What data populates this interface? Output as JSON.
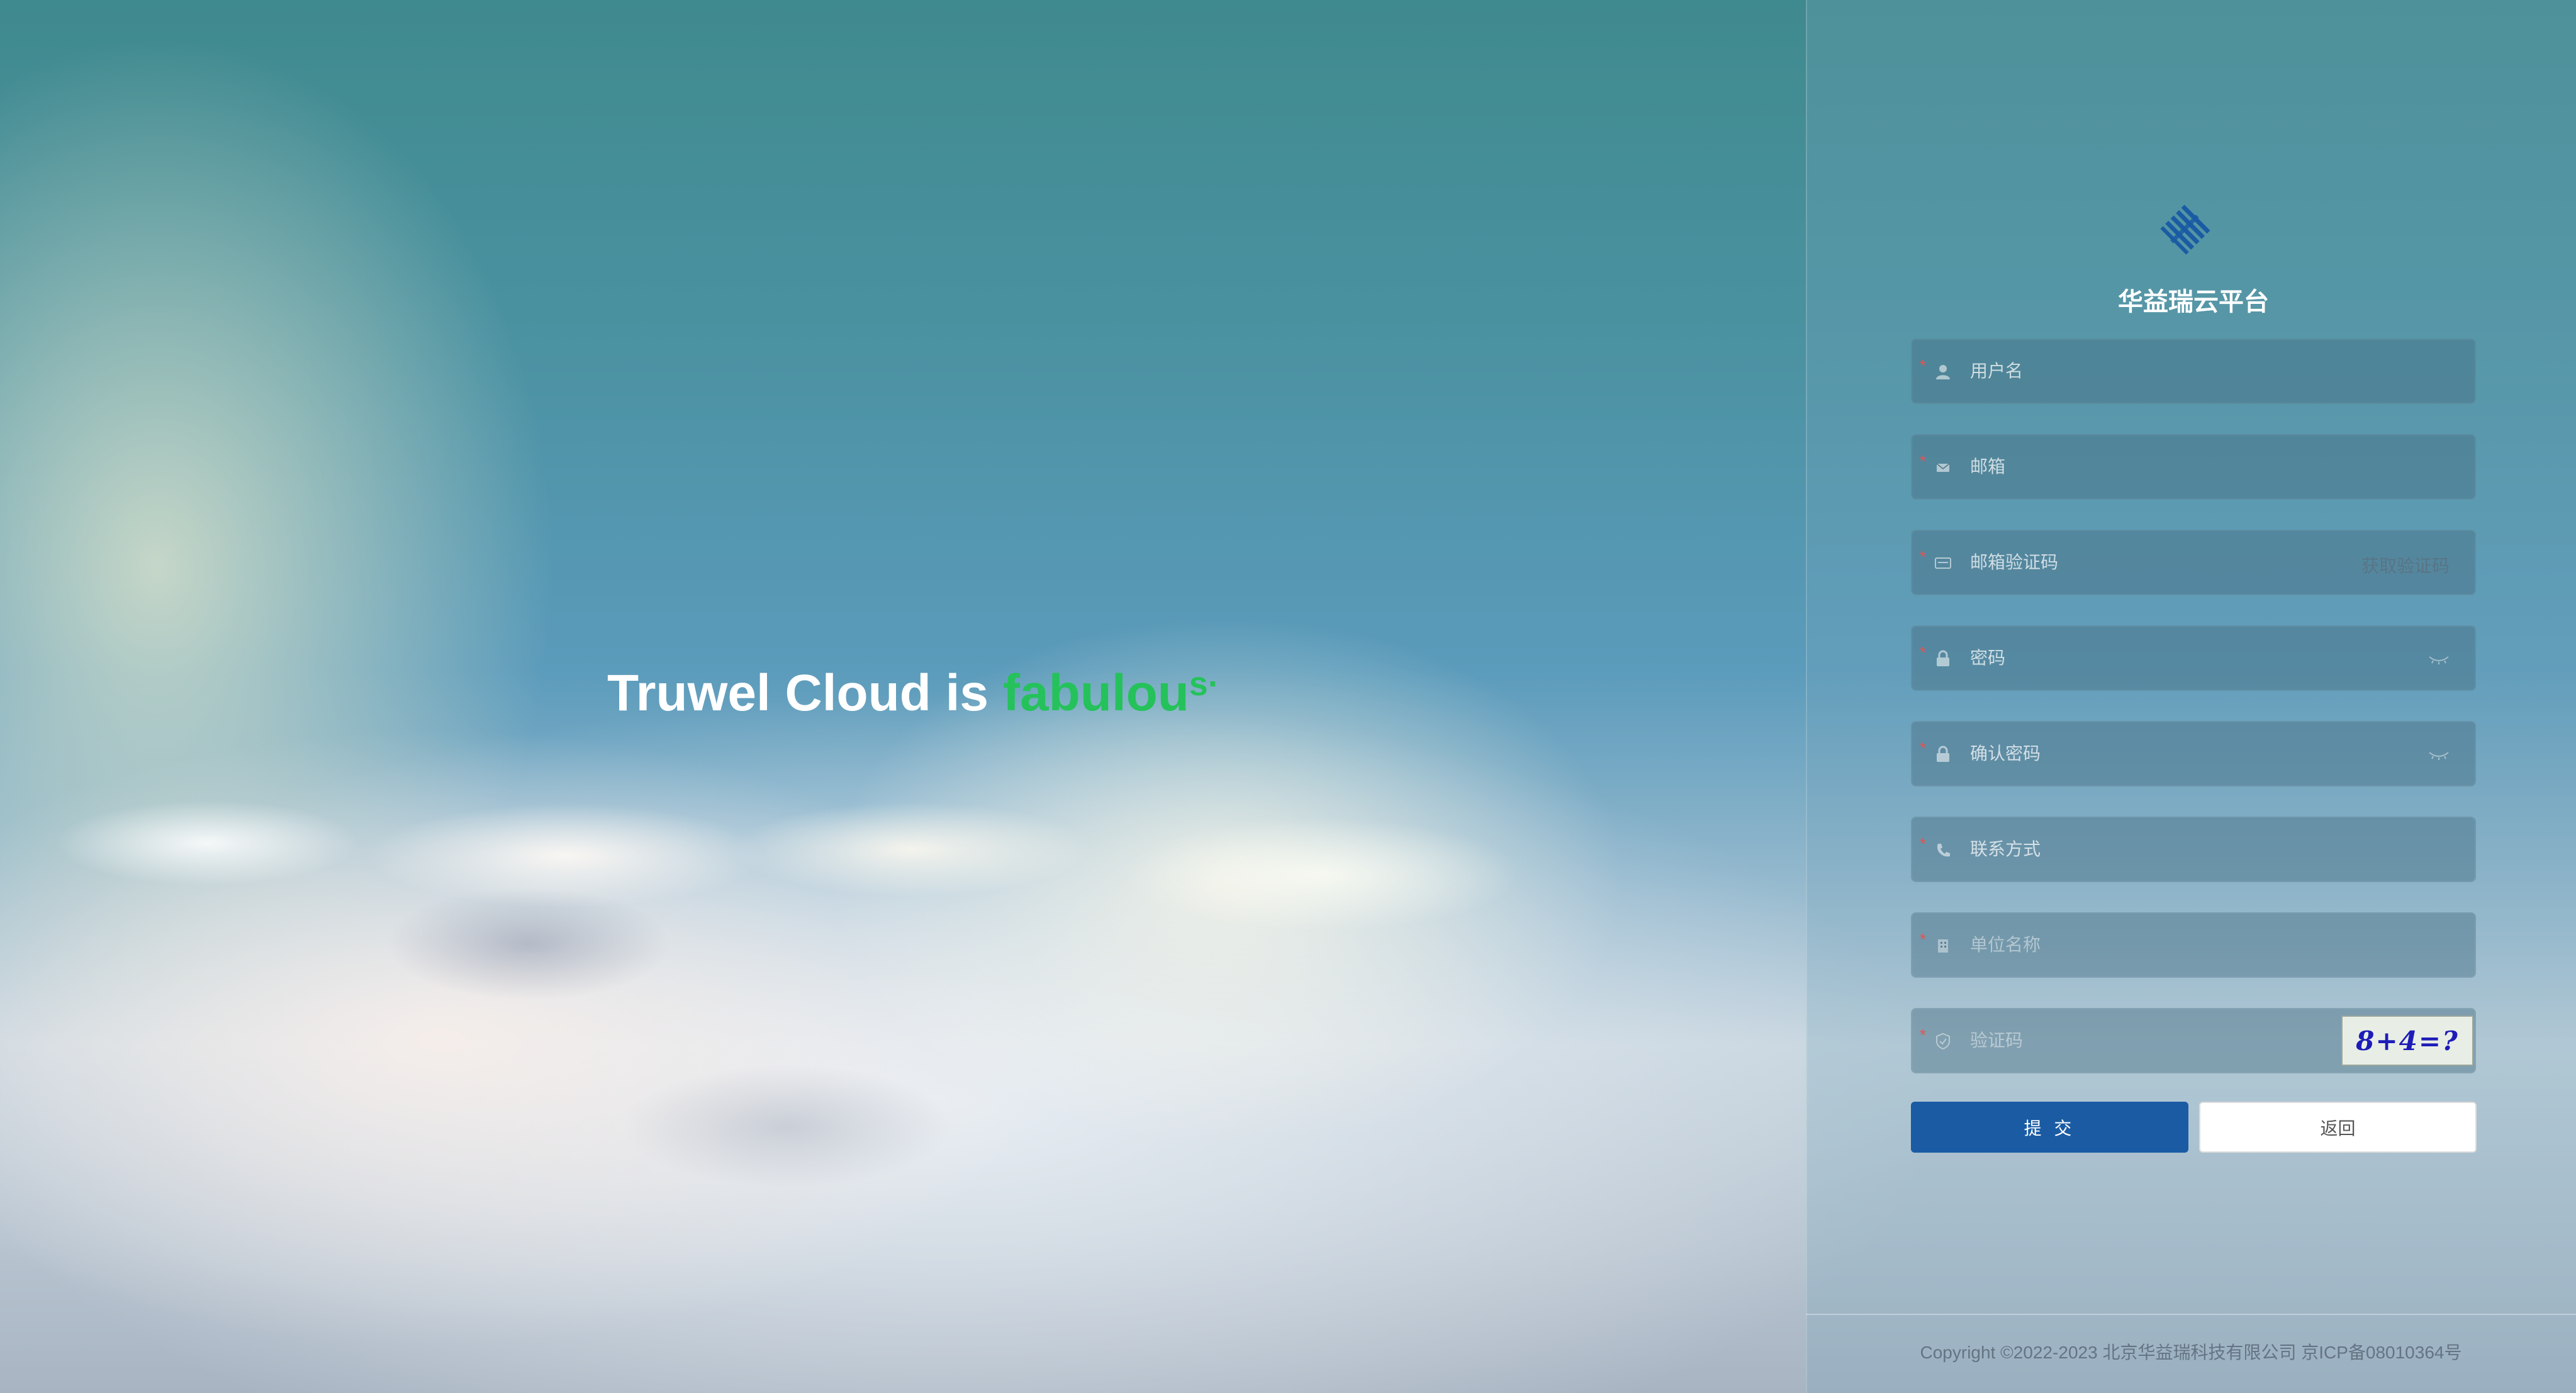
{
  "headline": {
    "prefix": "Truwel Cloud is ",
    "accent": "fabulou",
    "accent_tail": "s·"
  },
  "brand": {
    "logo": "diamond-stripes-logo",
    "name": "华益瑞云平台"
  },
  "form": {
    "username": {
      "icon": "user-icon",
      "placeholder": "用户名"
    },
    "email": {
      "icon": "mail-icon",
      "placeholder": "邮箱"
    },
    "email_code": {
      "icon": "card-icon",
      "placeholder": "邮箱验证码",
      "action": "获取验证码"
    },
    "password": {
      "icon": "lock-icon",
      "placeholder": "密码",
      "toggle": "eye-closed-icon"
    },
    "confirm_password": {
      "icon": "lock-icon",
      "placeholder": "确认密码",
      "toggle": "eye-closed-icon"
    },
    "contact": {
      "icon": "phone-icon",
      "placeholder": "联系方式"
    },
    "organization": {
      "icon": "building-icon",
      "placeholder": "单位名称"
    },
    "captcha": {
      "icon": "shield-icon",
      "placeholder": "验证码",
      "image_text": "8+4=?"
    }
  },
  "buttons": {
    "submit": "提 交",
    "back": "返回"
  },
  "footer": {
    "copyright": "Copyright ©2022-2023 北京华益瑞科技有限公司 京ICP备08010364号"
  },
  "colors": {
    "accent_green": "#25c25b",
    "primary_blue": "#1a5ba4",
    "required_red": "#e05555"
  }
}
